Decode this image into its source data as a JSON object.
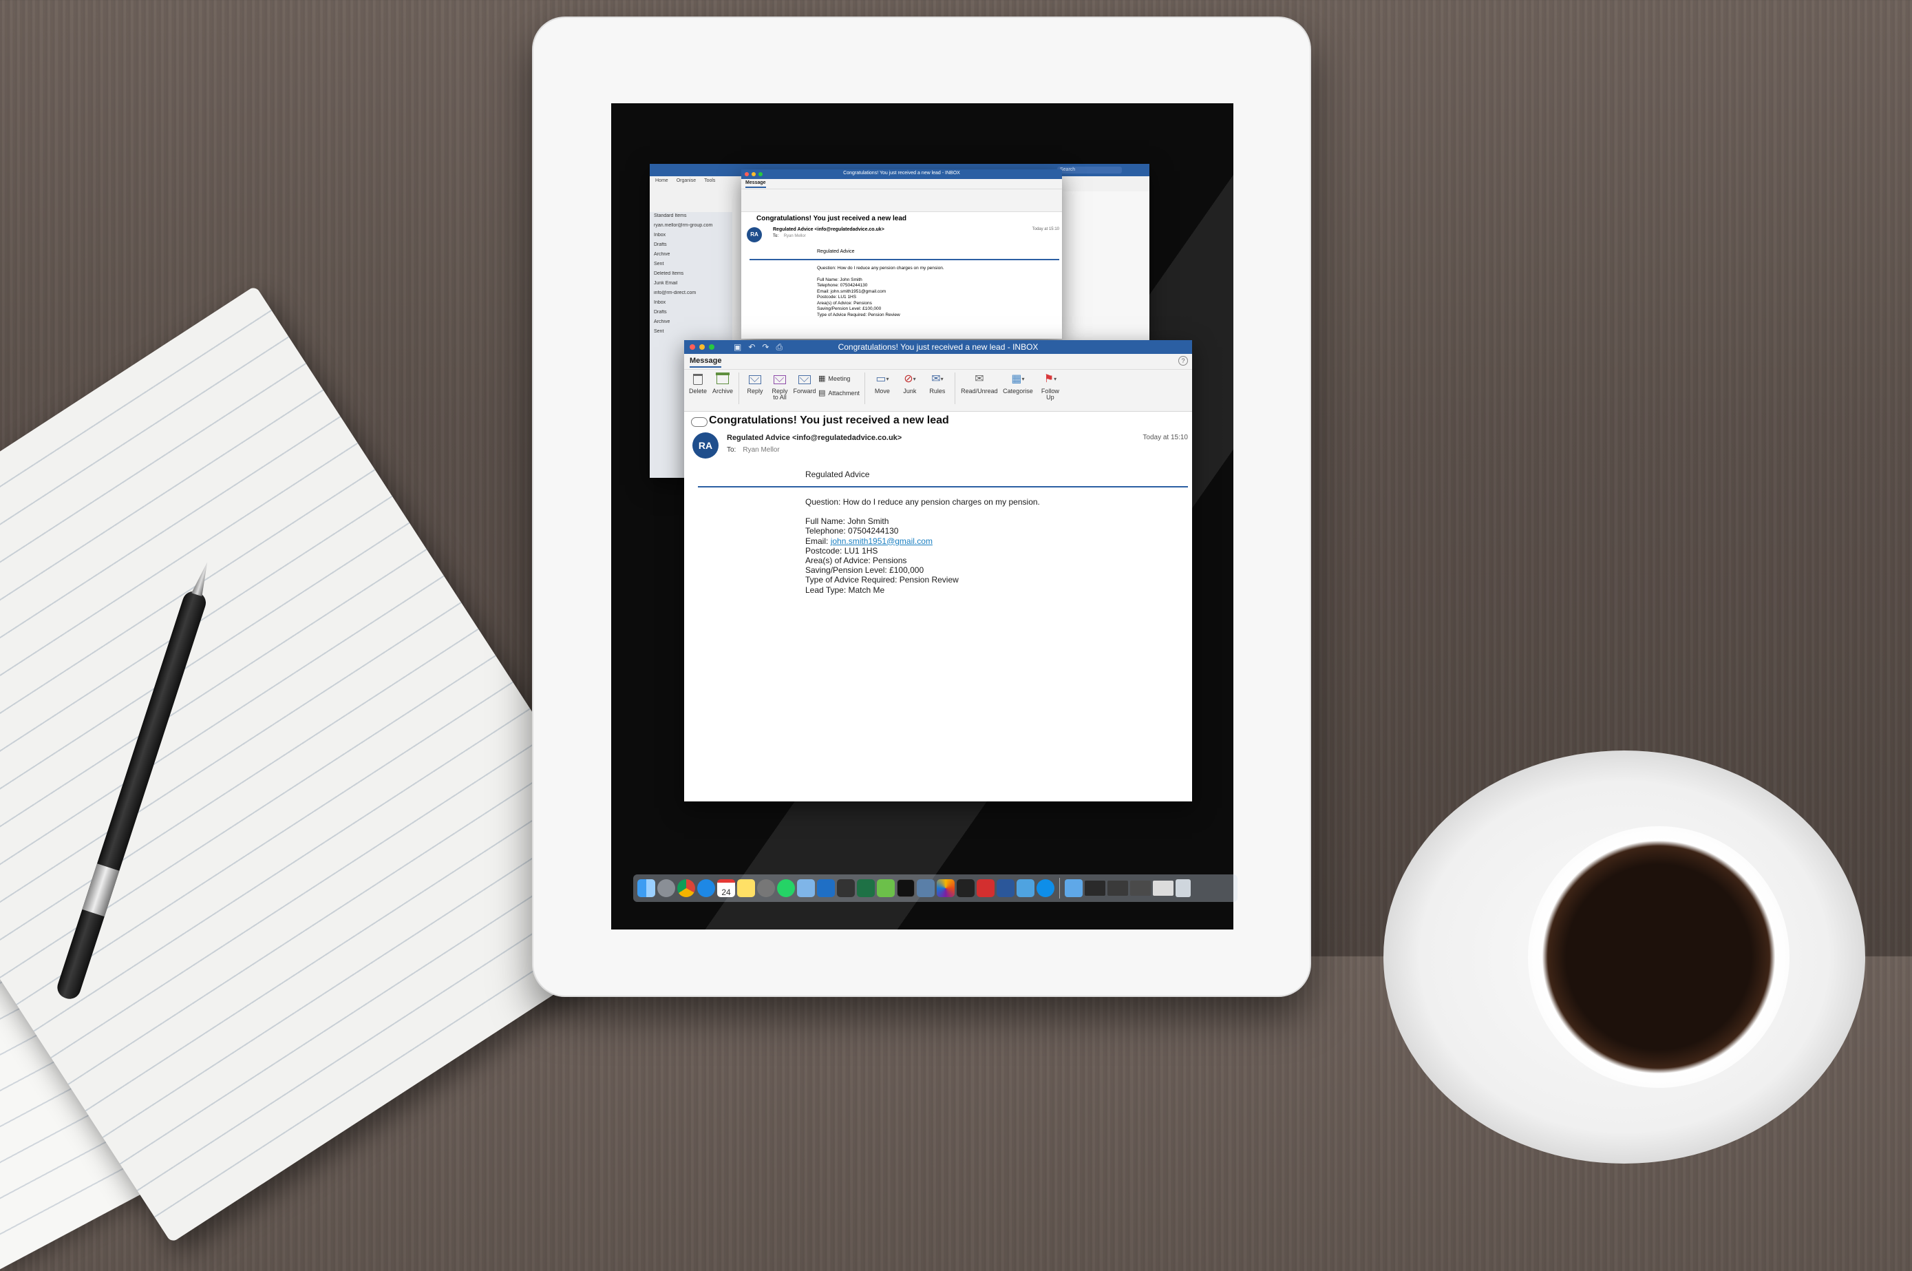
{
  "back_window": {
    "title": "Congratulations! You just received a new lead - INBOX",
    "tab": "Message",
    "subject": "Congratulations! You just received a new lead",
    "from": "Regulated Advice <info@regulatedadvice.co.uk>",
    "to_label": "To:",
    "to_name": "Ryan Mellor",
    "time": "Today at 15:10",
    "brand": "Regulated Advice",
    "question": "Question: How do I reduce any pension charges on my pension.",
    "lines": [
      "Full Name: John Smith",
      "Telephone: 07504244130",
      "Email: john.smith1951@gmail.com",
      "Postcode: LU1 1HS",
      "Area(s) of Advice: Pensions",
      "Saving/Pension Level: £100,000",
      "Type of Advice Required: Pension Review"
    ]
  },
  "main_window": {
    "tabs": [
      "Home",
      "Organise",
      "Tools"
    ],
    "search_placeholder": "Search",
    "sidebar": [
      "Standard Items",
      "ryan.mellor@rm-group.com",
      "Inbox",
      "Drafts",
      "Archive",
      "Sent",
      "Deleted Items",
      "Junk Email",
      "info@rm-direct.com",
      "Inbox",
      "Drafts",
      "Archive",
      "Sent"
    ]
  },
  "front_window": {
    "title": "Congratulations! You just received a new lead - INBOX",
    "tab": "Message",
    "ribbon": {
      "delete": "Delete",
      "archive": "Archive",
      "reply": "Reply",
      "reply_all": "Reply to All",
      "forward": "Forward",
      "meeting": "Meeting",
      "attachment": "Attachment",
      "move": "Move",
      "junk": "Junk",
      "rules": "Rules",
      "read_unread": "Read/Unread",
      "categorise": "Categorise",
      "follow_up": "Follow Up"
    },
    "subject": "Congratulations! You just received a new lead",
    "avatar": "RA",
    "from": "Regulated Advice <info@regulatedadvice.co.uk>",
    "to_label": "To:",
    "to_name": "Ryan Mellor",
    "time": "Today at 15:10",
    "brand": "Regulated Advice",
    "question": "Question: How do I reduce any pension charges on my pension.",
    "full_name": "Full Name: John Smith",
    "telephone": "Telephone: 07504244130",
    "email_label": "Email: ",
    "email": "john.smith1951@gmail.com",
    "postcode": "Postcode: LU1 1HS",
    "areas": "Area(s) of Advice: Pensions",
    "saving": "Saving/Pension Level: £100,000",
    "advice_type": "Type of Advice Required: Pension Review",
    "lead_type": "Lead Type: Match Me"
  },
  "dock": {
    "icons": [
      "finder-icon",
      "launchpad-icon",
      "chrome-icon",
      "safari-icon",
      "calendar-icon",
      "notes-icon",
      "system-preferences-icon",
      "whatsapp-icon",
      "preview-icon",
      "outlook-icon",
      "calculator-icon",
      "excel-icon",
      "maps-icon",
      "terminal-icon",
      "photos-icon",
      "sketch-icon",
      "activity-icon",
      "acrobat-icon",
      "word-icon",
      "photos2-icon",
      "teamviewer-icon",
      "folder-icon",
      "window1-icon",
      "window2-icon",
      "window3-icon",
      "window4-icon",
      "trash-icon"
    ],
    "calendar_day": "24"
  }
}
